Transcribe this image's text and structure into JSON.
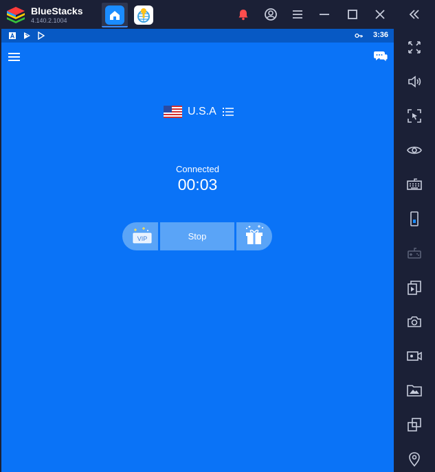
{
  "app": {
    "name": "BlueStacks",
    "version": "4.140.2.1004"
  },
  "tabs": [
    {
      "name": "home",
      "icon": "home-icon"
    },
    {
      "name": "vpn-app",
      "icon": "vpn-app-icon"
    }
  ],
  "title_actions": [
    "notification-bell-icon",
    "account-icon",
    "menu-icon",
    "minimize-icon",
    "maximize-icon",
    "close-icon"
  ],
  "android_status": {
    "time": "3:36",
    "icons": [
      "a-notification-icon",
      "play-games-icon",
      "play-store-icon",
      "vpn-key-icon"
    ]
  },
  "vpn": {
    "country": "U.S.A",
    "status": "Connected",
    "timer": "00:03",
    "stop_label": "Stop",
    "vip_label": "VIP"
  },
  "sidebar_tools": [
    "fullscreen-icon",
    "volume-icon",
    "pointer-lock-icon",
    "eye-icon",
    "keyboard-icon",
    "rotate-icon",
    "gamepad-icon",
    "install-apk-icon",
    "camera-icon",
    "video-record-icon",
    "media-folder-icon",
    "multi-instance-icon",
    "location-icon"
  ],
  "colors": {
    "screen_bg": "#0a73f7",
    "status_bar": "#0759c4",
    "chrome_bg": "#1b2036",
    "button_bg": "#5aa4f7",
    "notification": "#ff4d4d"
  }
}
